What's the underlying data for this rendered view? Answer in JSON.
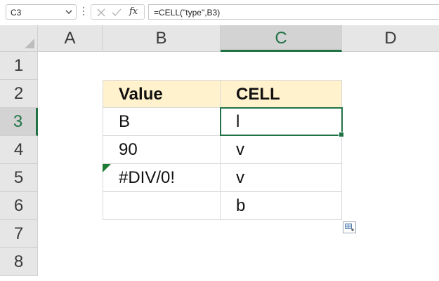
{
  "formula_bar": {
    "name_box": "C3",
    "formula": "=CELL(\"type\",B3)",
    "fx_label": "fx"
  },
  "columns": [
    "A",
    "B",
    "C",
    "D"
  ],
  "rows": [
    "1",
    "2",
    "3",
    "4",
    "5",
    "6",
    "7",
    "8"
  ],
  "selected": {
    "column": "C",
    "row": "3"
  },
  "table": {
    "headers": [
      "Value",
      "CELL"
    ],
    "rows": [
      [
        "B",
        "l"
      ],
      [
        "90",
        "v"
      ],
      [
        "#DIV/0!",
        "v"
      ],
      [
        "",
        "b"
      ]
    ]
  },
  "colors": {
    "accent": "#217346",
    "header_fill": "#fff2cc",
    "error_indicator": "#1e7b34"
  }
}
